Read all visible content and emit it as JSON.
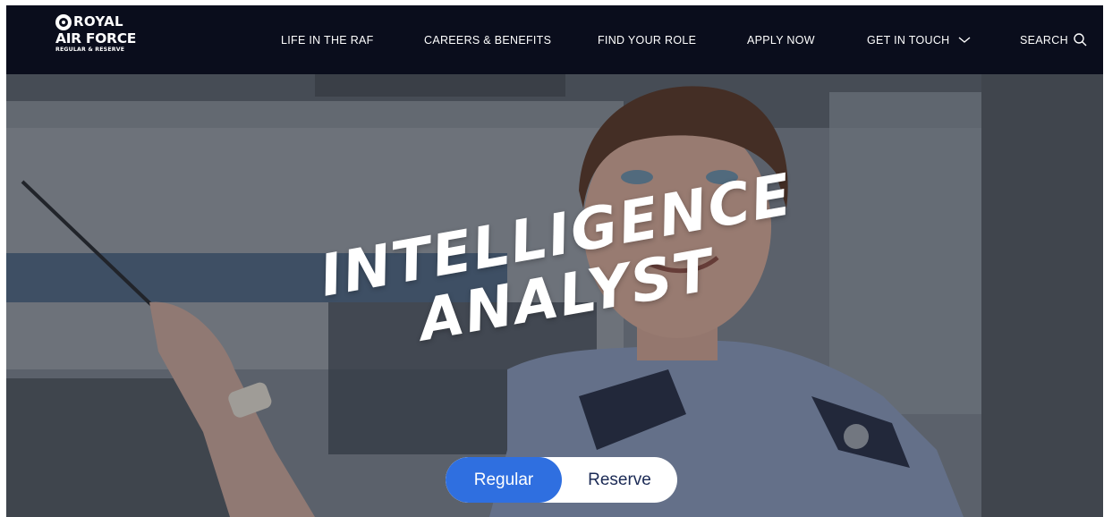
{
  "header": {
    "logo": {
      "line1": "ROYAL",
      "line2": "AIR FORCE",
      "line3": "REGULAR & RESERVE"
    },
    "nav": [
      {
        "label": "LIFE IN THE RAF"
      },
      {
        "label": "CAREERS & BENEFITS"
      },
      {
        "label": "FIND YOUR ROLE"
      },
      {
        "label": "APPLY NOW"
      },
      {
        "label": "GET IN TOUCH",
        "icon": "chevron-down-icon"
      },
      {
        "label": "SEARCH",
        "icon": "search-icon"
      }
    ]
  },
  "hero": {
    "title_line1": "INTELLIGENCE",
    "title_line2": "ANALYST",
    "toggle": {
      "options": [
        "Regular",
        "Reserve"
      ],
      "selected": "Regular"
    }
  },
  "colors": {
    "nav_bg": "#0a0d1c",
    "accent": "#2f6fe0",
    "toggle_text": "#1b2a55"
  }
}
